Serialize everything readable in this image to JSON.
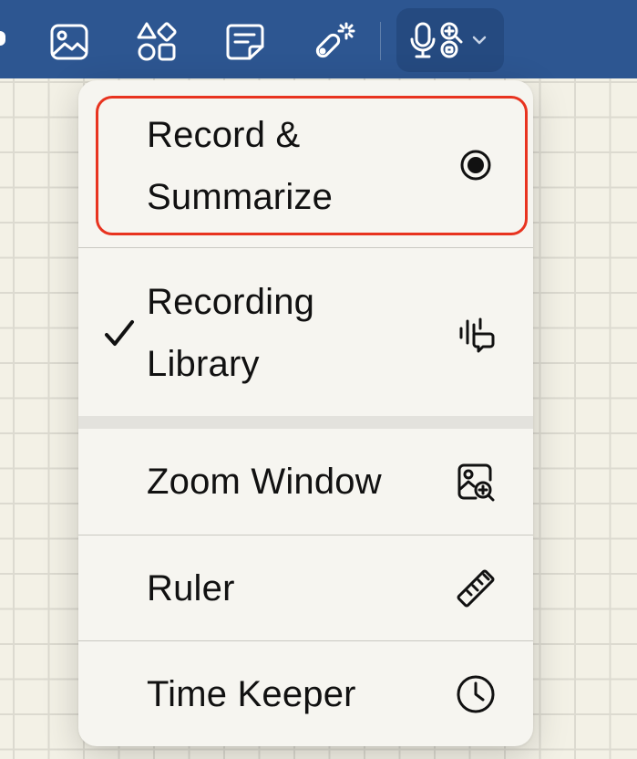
{
  "toolbar": {
    "icons": [
      "image-icon",
      "shapes-icon",
      "sticky-note-icon",
      "laser-pointer-icon",
      "microphone-icon",
      "recording-options-icon",
      "chevron-down-icon"
    ]
  },
  "menu": {
    "items": [
      {
        "label": "Record & Summarize",
        "icon": "record-icon",
        "checked": false,
        "highlighted": true
      },
      {
        "label": "Recording Library",
        "icon": "recording-library-icon",
        "checked": true
      },
      {
        "label": "Zoom Window",
        "icon": "zoom-window-icon",
        "checked": false
      },
      {
        "label": "Ruler",
        "icon": "ruler-icon",
        "checked": false
      },
      {
        "label": "Time Keeper",
        "icon": "clock-icon",
        "checked": false
      }
    ]
  },
  "colors": {
    "toolbar": "#2d5691",
    "menu_background": "#f6f5f0",
    "highlight_border": "#e8331f",
    "grid_background": "#f3f1e6"
  }
}
